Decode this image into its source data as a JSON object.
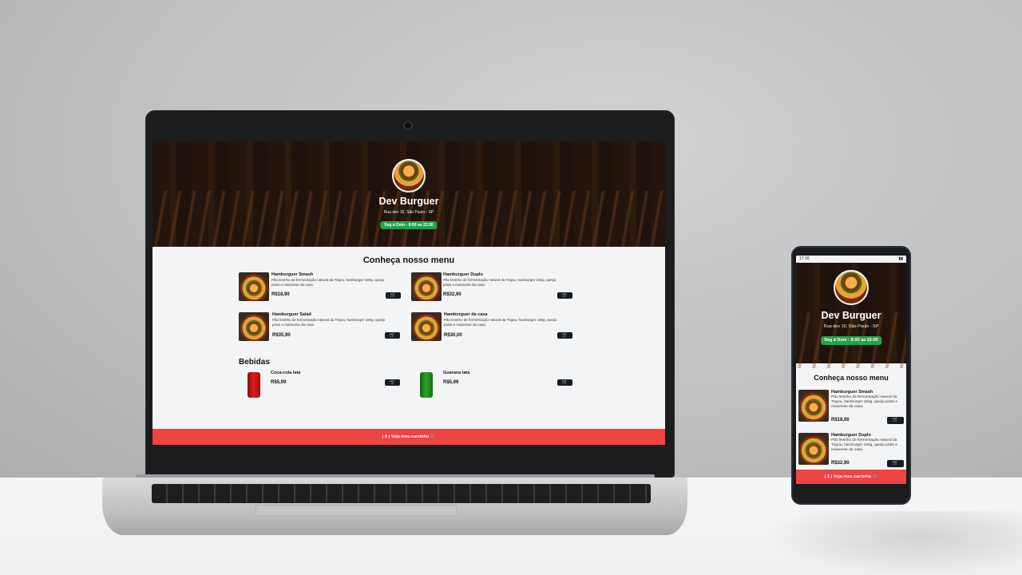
{
  "site": {
    "name": "Dev Burguer",
    "address": "Rua dev 10, São Paulo - SP",
    "hours": "Seg á Dom - 8:00 as 22:00",
    "menu_heading": "Conheça nosso menu",
    "drinks_heading": "Bebidas",
    "cart_icon": "cart-icon"
  },
  "laptop": {
    "cart_bar": "( 0 ) Veja meu carrinho",
    "burgers": [
      {
        "name": "Hamburguer Smash",
        "desc": "Pão levinho de fermentação natural da Trigou, hamburger 160g, queijo prato e maionese da casa.",
        "price": "R$18,90"
      },
      {
        "name": "Hamburguer Duplo",
        "desc": "Pão levinho de fermentação natural da Trigou, hamburger 160g, queijo prato e maionese da casa.",
        "price": "R$32,90"
      },
      {
        "name": "Hamburguer Salad",
        "desc": "Pão levinho de fermentação natural da Trigou, hamburger 160g, queijo prato e maionese da casa.",
        "price": "R$35,90"
      },
      {
        "name": "Hamburguer da casa",
        "desc": "Pão levinho de fermentação natural da Trigou, hamburger 160g, queijo prato e maionese da casa.",
        "price": "R$30,00"
      }
    ],
    "drinks": [
      {
        "name": "Coca-cola lata",
        "price": "R$5,99"
      },
      {
        "name": "Guarana lata",
        "price": "R$5,99"
      }
    ]
  },
  "phone": {
    "status_time": "17:16",
    "cart_bar": "( 2 ) Veja meu carrinho",
    "burgers": [
      {
        "name": "Hamburguer Smash",
        "desc": "Pão levinho de fermentação natural da Trigou, hamburger 160g, queijo prato e maionese da casa.",
        "price": "R$18,90"
      },
      {
        "name": "Hamburguer Duplo",
        "desc": "Pão levinho de fermentação natural da Trigou, hamburger 160g, queijo prato e maionese da casa.",
        "price": "R$32,90"
      }
    ]
  },
  "colors": {
    "accent_red": "#ee4444",
    "hours_green": "#22a447",
    "button_dark": "#1b1c22"
  }
}
